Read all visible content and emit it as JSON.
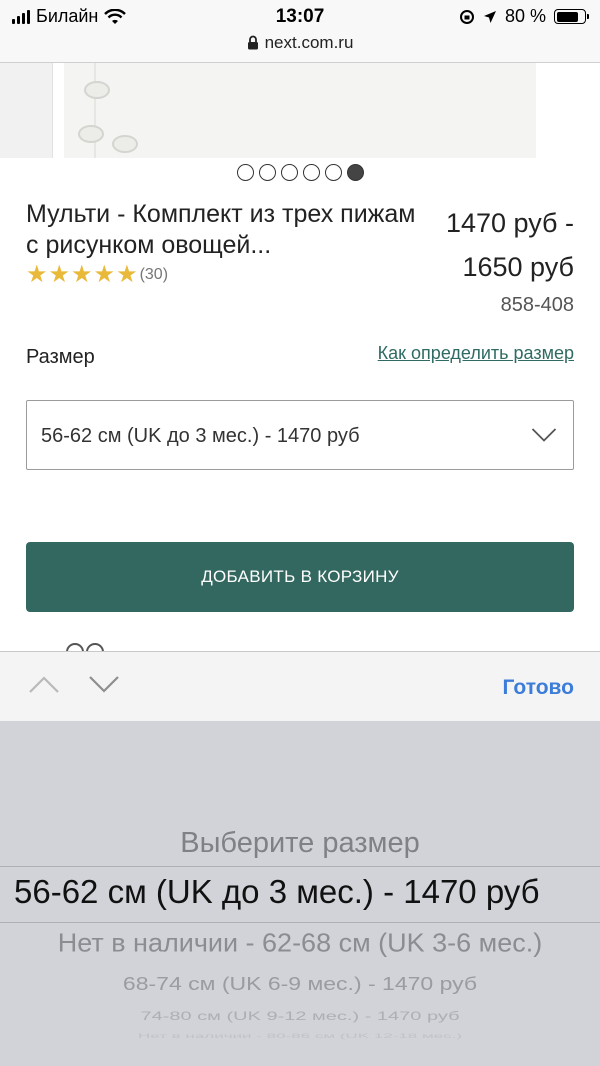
{
  "status_bar": {
    "carrier": "Билайн",
    "time": "13:07",
    "battery": "80 %",
    "battery_level": 0.8
  },
  "browser": {
    "url": "next.com.ru"
  },
  "carousel": {
    "page_count": 6,
    "active_index": 5
  },
  "product": {
    "title": "Мульти - Комплект из трех пижам с рисунком овощей...",
    "rating_stars": 5,
    "review_count": "(30)",
    "price_line1": "1470 руб -",
    "price_line2": "1650 руб",
    "sku": "858-408"
  },
  "size": {
    "label": "Размер",
    "guide_link": "Как определить размер",
    "selected_value": "56-62 см (UK до 3 мес.) - 1470 руб"
  },
  "cart": {
    "button_label": "ДОБАВИТЬ В КОРЗИНУ"
  },
  "keyboard_bar": {
    "done_label": "Готово"
  },
  "picker": {
    "options": [
      "Выберите размер",
      "56-62 см (UK до 3 мес.) - 1470 руб",
      "Нет в наличии - 62-68 см (UK 3-6 мес.)",
      "68-74 см (UK 6-9 мес.) - 1470 руб",
      "74-80 см (UK 9-12 мес.) - 1470 руб",
      "Нет в наличии - 80-86 см (UK 12-18 мес.)"
    ],
    "selected_index": 1
  },
  "colors": {
    "accent": "#336860",
    "link": "#2f6b62",
    "star": "#e9b93a",
    "ios_blue": "#3b7dd8",
    "picker_bg": "#d1d3d9"
  },
  "icons": [
    "signal-icon",
    "wifi-icon",
    "rotation-lock-icon",
    "location-icon",
    "battery-icon",
    "lock-icon",
    "chevron-down-icon",
    "chevron-up-icon",
    "star-icon"
  ]
}
